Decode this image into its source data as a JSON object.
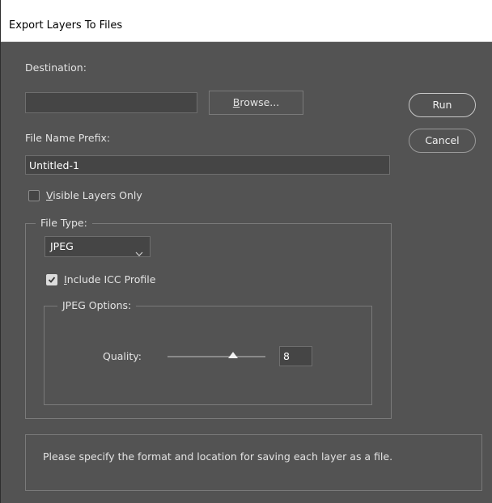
{
  "window": {
    "title": "Export Layers To Files"
  },
  "destination": {
    "label": "Destination:",
    "value": "",
    "browse_label_first": "B",
    "browse_label_rest": "rowse..."
  },
  "prefix": {
    "label": "File Name Prefix:",
    "value": "Untitled-1"
  },
  "visible_only": {
    "label_first": "V",
    "label_rest": "isible Layers Only",
    "checked": false
  },
  "file_type": {
    "legend": "File Type:",
    "selected": "JPEG",
    "include_icc": {
      "label_first": "I",
      "label_rest": "nclude ICC Profile",
      "checked": true
    }
  },
  "jpeg_options": {
    "legend": "JPEG Options:",
    "quality_label": "Quality:",
    "quality_value": "8",
    "quality_fraction": 0.67
  },
  "buttons": {
    "run": "Run",
    "cancel": "Cancel"
  },
  "status": {
    "message": "Please specify the format and location for saving each layer as a file."
  },
  "icons": {
    "dropdown": "chevron-down-icon",
    "check": "check-icon",
    "thumb": "slider-thumb-icon"
  }
}
